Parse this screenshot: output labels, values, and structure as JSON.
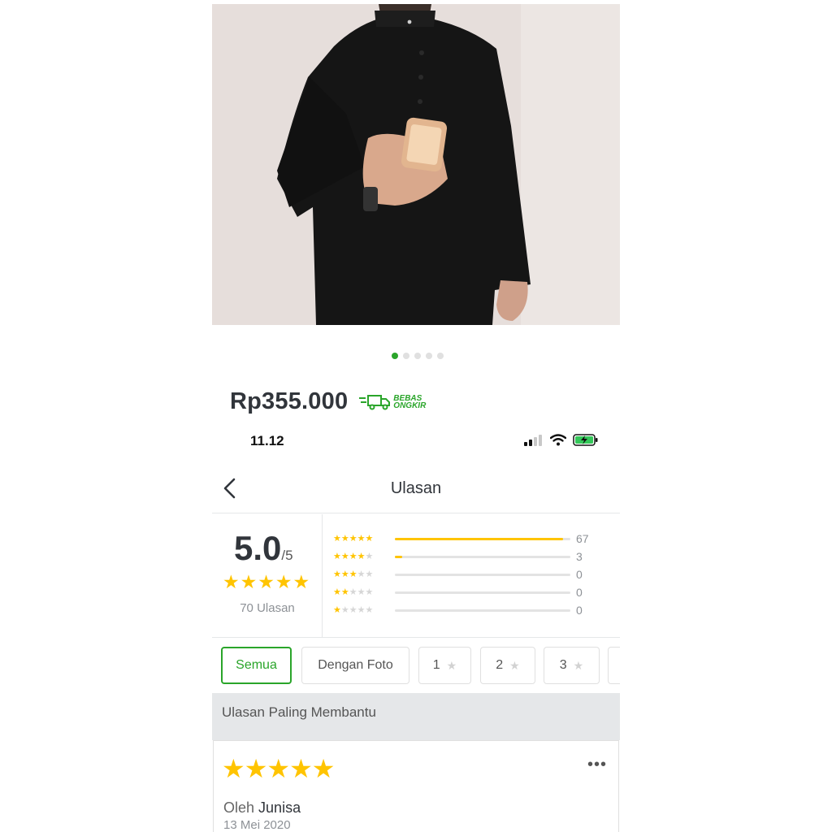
{
  "product": {
    "price": "Rp355.000",
    "shipping_badge": {
      "line1": "BEBAS",
      "line2": "ONGKIR"
    },
    "image_dots": {
      "total": 5,
      "active": 0
    }
  },
  "status_bar": {
    "time": "11.12"
  },
  "header": {
    "title": "Ulasan"
  },
  "rating": {
    "score": "5.0",
    "out_of": "/5",
    "review_count": "70 Ulasan",
    "breakdown": [
      {
        "stars": 5,
        "count": "67",
        "fraction": 0.96
      },
      {
        "stars": 4,
        "count": "3",
        "fraction": 0.04
      },
      {
        "stars": 3,
        "count": "0",
        "fraction": 0
      },
      {
        "stars": 2,
        "count": "0",
        "fraction": 0
      },
      {
        "stars": 1,
        "count": "0",
        "fraction": 0
      }
    ]
  },
  "filters": {
    "all": "Semua",
    "with_photo": "Dengan Foto",
    "star1": "1",
    "star2": "2",
    "star3": "3"
  },
  "section": {
    "title": "Ulasan Paling Membantu"
  },
  "review": {
    "stars": 5,
    "by_label": "Oleh",
    "author": "Junisa",
    "date": "13 Mei 2020"
  },
  "colors": {
    "accent": "#2aa52a",
    "star": "#ffc400"
  }
}
